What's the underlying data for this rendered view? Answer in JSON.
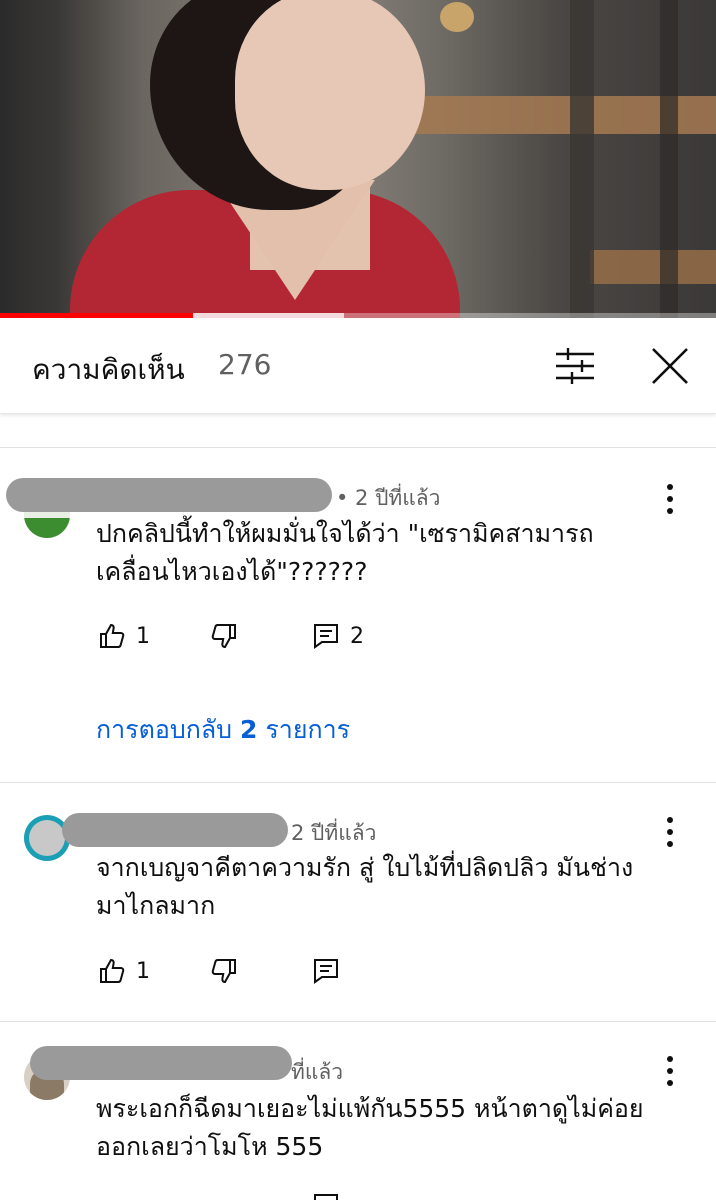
{
  "video": {
    "progress_percent": 27,
    "buffered_percent": 48
  },
  "comments_panel": {
    "title": "ความคิดเห็น",
    "count": "276",
    "filter_icon": "filter-sliders-icon",
    "close_icon": "close-icon"
  },
  "comments": [
    {
      "time": "• 2 ปีที่แล้ว",
      "text_line1": "ปกคลิปนี้ทำให้ผมมั่นใจได้ว่า \"เซรามิคสามารถ",
      "text_line2": "เคลื่อนไหวเองได้\"??????",
      "likes": "1",
      "reply_count": "2",
      "replies_link": "การตอบกลับ ",
      "replies_link_count": "2",
      "replies_link_suffix": " รายการ",
      "avatar_color": "#3c8d2f"
    },
    {
      "time": "2 ปีที่แล้ว",
      "text_line1": "จากเบญจาคีตาความรัก สู่ ใบไม้ที่ปลิดปลิว มันช่าง",
      "text_line2": "มาไกลมาก",
      "likes": "1",
      "avatar_color": "#1a9fb5"
    },
    {
      "time": "ที่แล้ว",
      "text_line1": "พระเอกก็ฉีดมาเยอะไม่แพ้กัน5555 หน้าตาดูไม่ค่อย",
      "text_line2": "ออกเลยว่าโมโห 555",
      "avatar_color": "#8a7a66"
    }
  ],
  "colors": {
    "accent_link": "#065fd4",
    "progress": "#ff0000"
  }
}
